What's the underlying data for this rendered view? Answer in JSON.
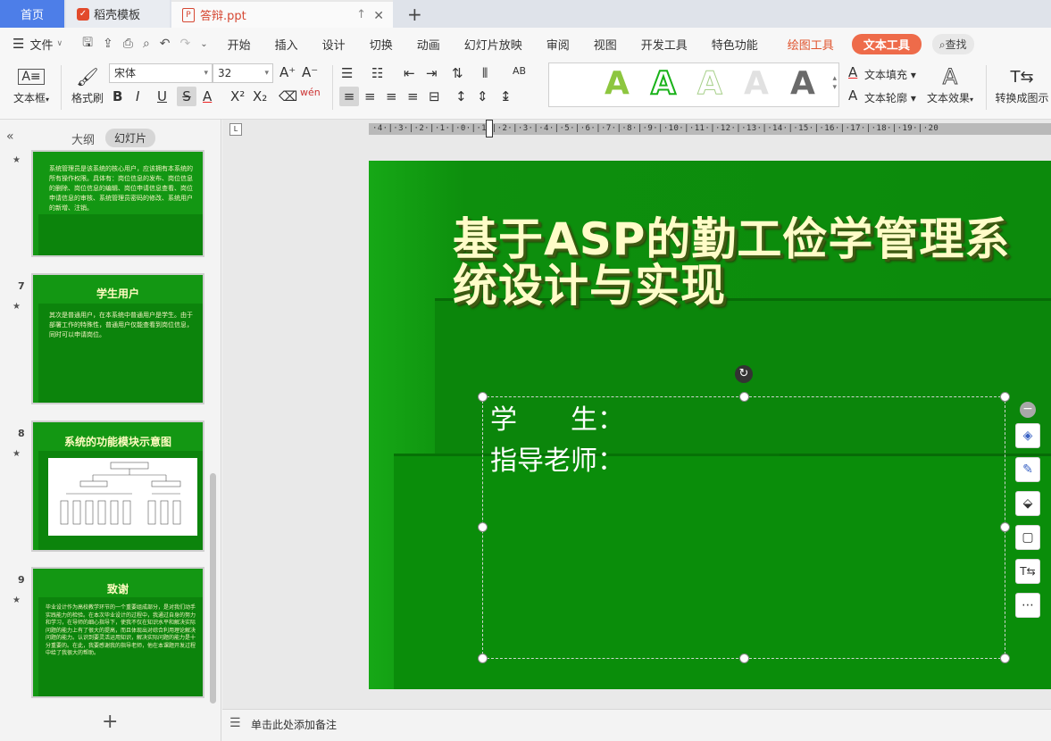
{
  "tabs": {
    "home": "首页",
    "template": "稻壳模板",
    "file": "答辩.ppt"
  },
  "menu": {
    "file": "文件",
    "items": [
      "开始",
      "插入",
      "设计",
      "切换",
      "动画",
      "幻灯片放映",
      "审阅",
      "视图",
      "开发工具",
      "特色功能"
    ],
    "draw_tools": "绘图工具",
    "text_tools": "文本工具",
    "search": "查找"
  },
  "ribbon": {
    "textbox": "文本框",
    "format_painter": "格式刷",
    "font_name": "宋体",
    "font_size": "32",
    "text_fill": "文本填充",
    "text_outline": "文本轮廓",
    "text_effect": "文本效果",
    "convert": "转换成图示",
    "gallery_glyph": "A"
  },
  "left_panel": {
    "outline_tab": "大纲",
    "slides_tab": "幻灯片",
    "thumbs": [
      {
        "num": "",
        "title": "",
        "body": "系统管理员是该系统的核心用户，应该拥有本系统的所有操作权限。具体有：岗位信息的发布、岗位信息的删除、岗位信息的编辑、岗位申请信息查看、岗位申请信息的审核、系统管理员密码的修改、系统用户的新增、注销。"
      },
      {
        "num": "7",
        "title": "学生用户",
        "body": "其次是普通用户，在本系统中普通用户是学生。由于部署工作的特殊性，普通用户仅能查看到岗位信息，同时可以申请岗位。"
      },
      {
        "num": "8",
        "title": "系统的功能模块示意图",
        "body": ""
      },
      {
        "num": "9",
        "title": "致谢",
        "body": "毕业设计作为高校教学环节的一个重要组成部分，是对我们动手实践能力的检验。在本次毕业设计的过程中，我通过自身的努力和学习，在导师的细心指导下，使我不仅在知识水平和解决实际问题的能力上有了很大的提高，而且体现出对综合利用理论解决问题的能力。认识到要灵活运用知识，解决实际问题的能力是十分重要的。在此，我要感谢我的指导老师，他在本课题开发过程中给了我很大的帮助。"
      }
    ]
  },
  "slide": {
    "title": "基于ASP的勤工俭学管理系统设计与实现",
    "line1": "学　　生：",
    "line2": "指导老师："
  },
  "notes": "单击此处添加备注",
  "ruler": "·4·|·3·|·2·|·1·|·0·|·1·|·2·|·3·|·4·|·5·|·6·|·7·|·8·|·9·|·10·|·11·|·12·|·13·|·14·|·15·|·16·|·17·|·18·|·19·|·20"
}
